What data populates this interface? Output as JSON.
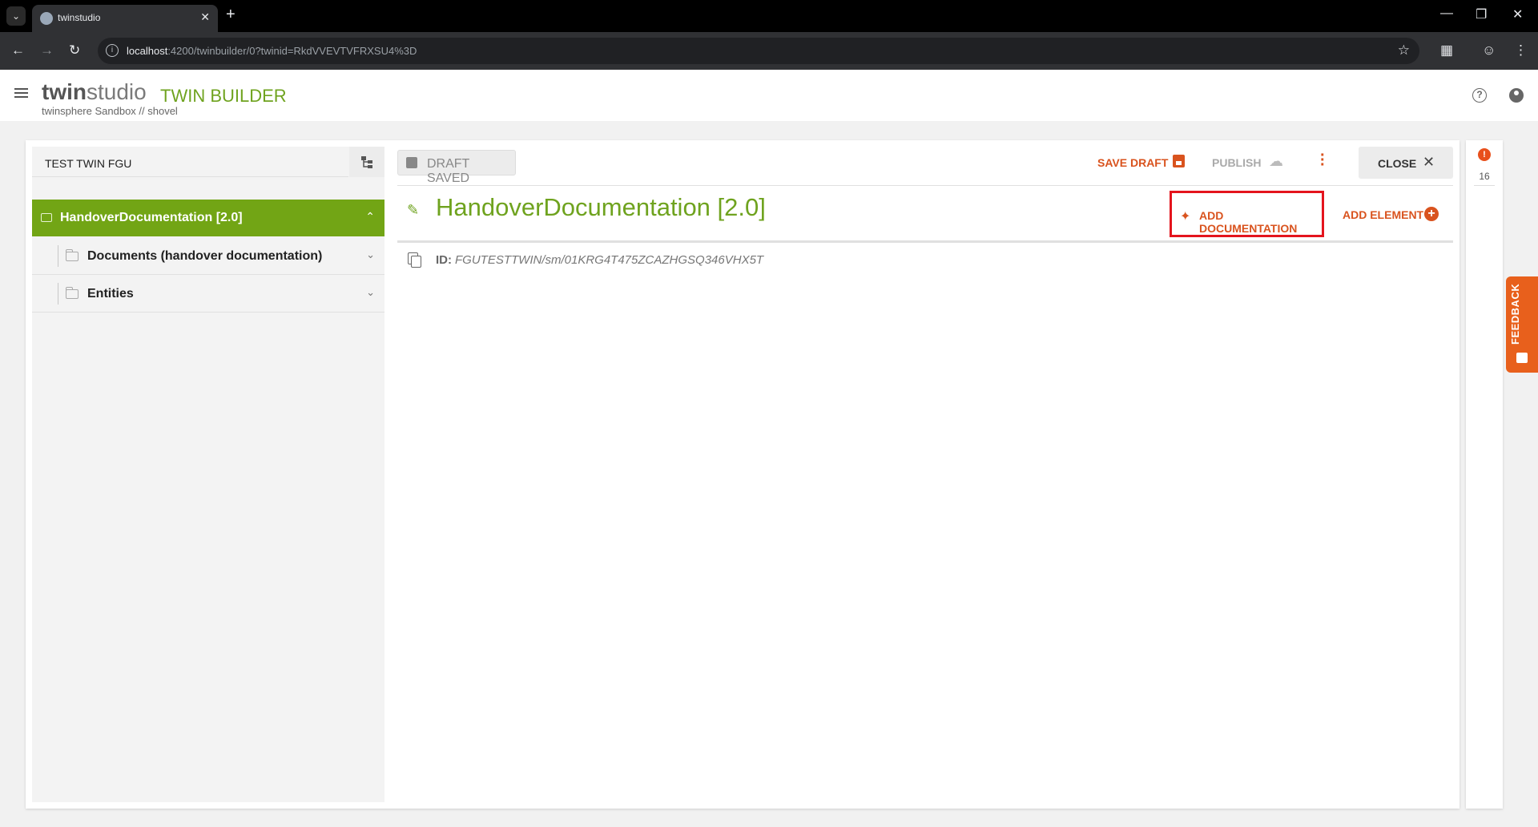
{
  "browser": {
    "tab_title": "twinstudio",
    "url_host": "localhost",
    "url_path": ":4200/twinbuilder/0?twinid=RkdVVEVTVFRXSU4%3D"
  },
  "header": {
    "brand_bold": "twin",
    "brand_light": "studio",
    "module": "TWIN BUILDER",
    "subtitle": "twinsphere Sandbox // shovel"
  },
  "left_panel": {
    "twin_name": "TEST TWIN FGU",
    "tree_root": "HandoverDocumentation [2.0]",
    "tree_items": [
      {
        "label": "Documents (handover documentation)"
      },
      {
        "label": "Entities"
      }
    ]
  },
  "toolbar": {
    "draft_status": "DRAFT SAVED",
    "save_draft": "SAVE DRAFT",
    "publish": "PUBLISH",
    "close": "CLOSE"
  },
  "detail": {
    "title": "HandoverDocumentation [2.0]",
    "add_documentation": "ADD DOCUMENTATION",
    "add_element": "ADD ELEMENT",
    "id_label": "ID:",
    "id_value": "FGUTESTTWIN/sm/01KRG4T475ZCAZHGSQ346VHX5T"
  },
  "side": {
    "alert_count": "16",
    "feedback": "FEEDBACK"
  },
  "colors": {
    "brand_green": "#72a515",
    "accent_orange": "#d9531e",
    "highlight_red": "#e4141d"
  }
}
